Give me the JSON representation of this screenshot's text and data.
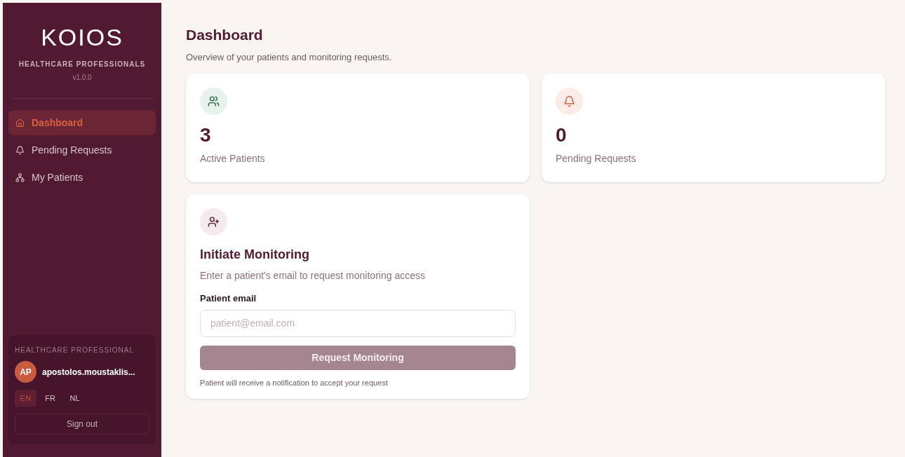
{
  "sidebar": {
    "logo": "KOIOS",
    "subtitle": "HEALTHCARE PROFESSIONALS",
    "version": "v1.0.0",
    "items": [
      {
        "label": "Dashboard",
        "kind": "home",
        "selected": true
      },
      {
        "label": "Pending Requests",
        "kind": "bell",
        "selected": false
      },
      {
        "label": "My Patients",
        "kind": "network",
        "selected": false
      }
    ],
    "user": {
      "role": "HEALTHCARE PROFESSIONAL",
      "initials": "AP",
      "name": "apostolos.moustaklis...",
      "languages": [
        {
          "label": "EN",
          "selected": true
        },
        {
          "label": "FR",
          "selected": false
        },
        {
          "label": "NL",
          "selected": false
        }
      ],
      "sign_out": "Sign out"
    }
  },
  "header": {
    "title": "Dashboard",
    "subtitle": "Overview of your patients and monitoring requests."
  },
  "stats": [
    {
      "kind": "patients",
      "value": "3",
      "label": "Active Patients"
    },
    {
      "kind": "requests",
      "value": "0",
      "label": "Pending Requests"
    }
  ],
  "monitoring": {
    "title": "Initiate Monitoring",
    "description": "Enter a patient's email to request monitoring access",
    "field_label": "Patient email",
    "placeholder": "patient@email.com",
    "button": {
      "label": "Request Monitoring",
      "disabled": true
    },
    "note": "Patient will receive a notification to accept your request"
  }
}
